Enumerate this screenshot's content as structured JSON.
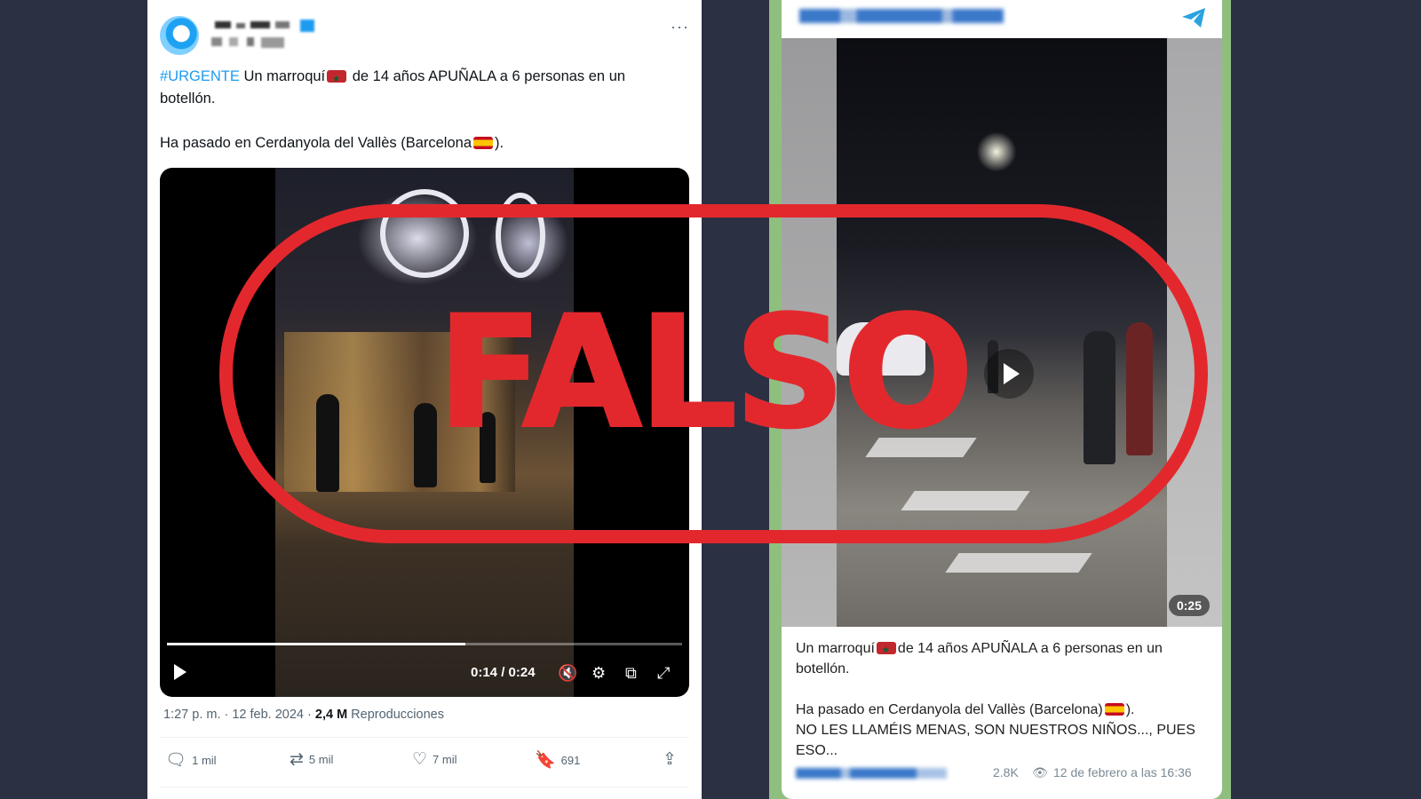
{
  "tweet": {
    "more_label": "···",
    "text_line1_hashtag": "#URGENTE",
    "text_line1_a": " Un marroquí",
    "text_line1_b": " de 14 años APUÑALA a 6 personas en un botellón.",
    "text_line2_a": "Ha pasado en Cerdanyola del Vallès (Barcelona",
    "text_line2_b": ").",
    "video": {
      "progress": 0.58,
      "time": "0:14 / 0:24",
      "icons": [
        "play-icon",
        "mute-icon",
        "settings-icon",
        "pip-icon",
        "fullscreen-icon"
      ]
    },
    "meta_time": "1:27 p. m. · 12 feb. 2024 · ",
    "meta_views": "2,4 M",
    "meta_views_label": " Reproducciones",
    "actions": {
      "replies": "1 mil",
      "retweets": "5 mil",
      "likes": "7 mil",
      "bookmarks": "691"
    }
  },
  "telegram": {
    "duration": "0:25",
    "text_line1_a": "Un marroquí",
    "text_line1_b": "de 14 años APUÑALA a 6 personas en un botellón.",
    "text_line2_a": "Ha pasado en Cerdanyola del Vallès (Barcelona)",
    "text_line2_b": ").",
    "text_line3": "NO LES LLAMÉIS MENAS, SON NUESTROS NIÑOS..., PUES ESO...",
    "views": "2.8K",
    "date": "12 de febrero a las 16:36"
  },
  "stamp": {
    "label": "FALSO",
    "color": "#e3282d"
  },
  "colors": {
    "background": "#2b3043",
    "twitter_blue": "#1d9bf0",
    "telegram_blue": "#2aa3e0"
  }
}
